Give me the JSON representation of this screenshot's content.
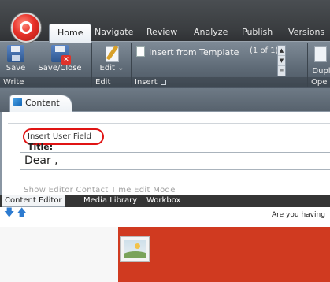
{
  "ribbon": {
    "tabs": [
      "Home",
      "Navigate",
      "Review",
      "Analyze",
      "Publish",
      "Versions"
    ],
    "groups": {
      "write": {
        "label": "Write",
        "buttons": [
          {
            "label": "Save",
            "icon": "save-icon"
          },
          {
            "label": "Save/Close",
            "icon": "save-close-icon"
          }
        ]
      },
      "edit": {
        "label": "Edit",
        "button": {
          "label": "Edit",
          "icon": "edit-icon"
        }
      },
      "insert": {
        "label": "Insert",
        "item": "Insert from Template",
        "pager": "(1 of 1)"
      },
      "open": {
        "label": "Ope",
        "button": "Dupl"
      }
    }
  },
  "content_tab": {
    "label": "Content"
  },
  "editor": {
    "insert_user_field": "Insert User Field",
    "title_label": "Title:",
    "title_value": "Dear ,",
    "faded_text": "Show Editor   Contact Time   Edit Mode"
  },
  "bottom_tabs": [
    "Content Editor",
    "Media Library",
    "Workbox"
  ],
  "preview": {
    "teaser": "Are you having"
  },
  "colors": {
    "highlight_circle": "#e01414",
    "preview_banner": "#d03a20",
    "nav_arrow": "#2d7bd0"
  }
}
